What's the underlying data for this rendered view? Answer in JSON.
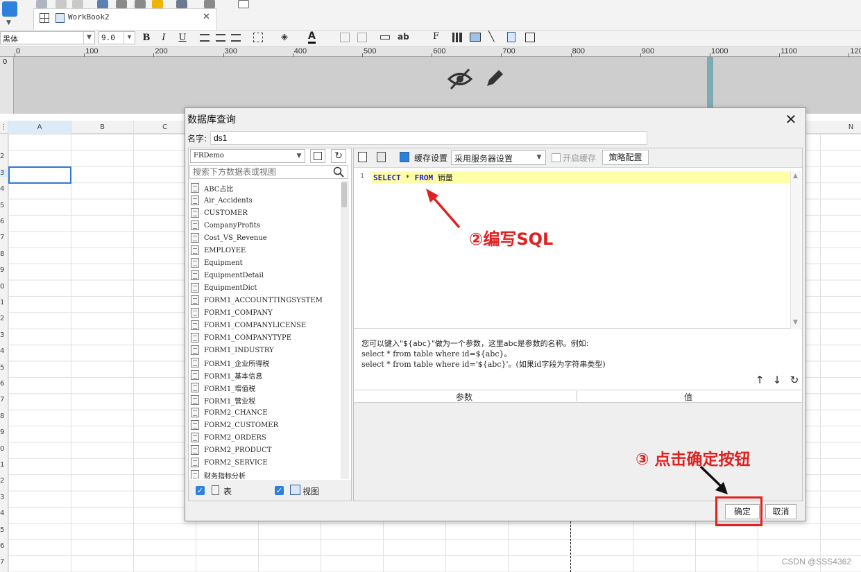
{
  "toolbar": {
    "workbook_tab": "WorkBook2",
    "font_name": "黑体",
    "font_size": "9.0",
    "bold_label": "B",
    "italic_label": "I",
    "underline_label": "U"
  },
  "ruler": {
    "marks": [
      "0",
      "100",
      "200",
      "300",
      "400",
      "500",
      "600",
      "700",
      "800",
      "900",
      "1000",
      "1100",
      "120"
    ]
  },
  "sheet": {
    "columns": [
      "A",
      "B",
      "C",
      "N"
    ],
    "rows": [
      "",
      "2",
      "3",
      "4",
      "5",
      "6",
      "7",
      "8",
      "9",
      "0",
      "1",
      "2",
      "3",
      "4",
      "5",
      "6",
      "7",
      "8",
      "9",
      "0",
      "1",
      "2",
      "3",
      "4",
      "5",
      "6",
      "7"
    ]
  },
  "dialog": {
    "title": "数据库查询",
    "close_symbol": "✕",
    "name_label": "名字:",
    "name_value": "ds1",
    "datasource": "FRDemo",
    "search_placeholder": "搜索下方数据表或视图",
    "tables": [
      "ABC占比",
      "Air_Accidents",
      "CUSTOMER",
      "CompanyProfits",
      "Cost_VS_Revenue",
      "EMPLOYEE",
      "Equipment",
      "EquipmentDetail",
      "EquipmentDict",
      "FORM1_ACCOUNTTINGSYSTEM",
      "FORM1_COMPANY",
      "FORM1_COMPANYLICENSE",
      "FORM1_COMPANYTYPE",
      "FORM1_INDUSTRY",
      "FORM1_企业所得税",
      "FORM1_基本信息",
      "FORM1_增值税",
      "FORM1_营业税",
      "FORM2_CHANCE",
      "FORM2_CUSTOMER",
      "FORM2_ORDERS",
      "FORM2_PRODUCT",
      "FORM2_SERVICE",
      "财务指标分析"
    ],
    "show_tables_label": "表",
    "show_views_label": "视图",
    "cache_label": "缓存设置",
    "server_setting": "采用服务器设置",
    "open_cache_label": "开启缓存",
    "strategy_label": "策略配置",
    "sql": {
      "line_number": "1",
      "kw_select": "SELECT",
      "star": "*",
      "kw_from": "FROM",
      "table": "销量"
    },
    "hint_line1": "您可以键入\"${abc}\"做为一个参数，这里abc是参数的名称。例如:",
    "hint_line2": "select * from table where id=${abc}。",
    "hint_line3": "select * from table where id='${abc}'。(如果id字段为字符串类型)",
    "param_col": "参数",
    "value_col": "值",
    "ok_label": "确定",
    "cancel_label": "取消"
  },
  "annotations": {
    "step2": "②编写SQL",
    "step3": "③ 点击确定按钮"
  },
  "watermark": "CSDN @SSS4362",
  "colors": {
    "accent": "#2b78d6",
    "annotation": "#e02020",
    "sql_keyword": "#1a1ad0",
    "line_highlight": "#ffffa8"
  }
}
